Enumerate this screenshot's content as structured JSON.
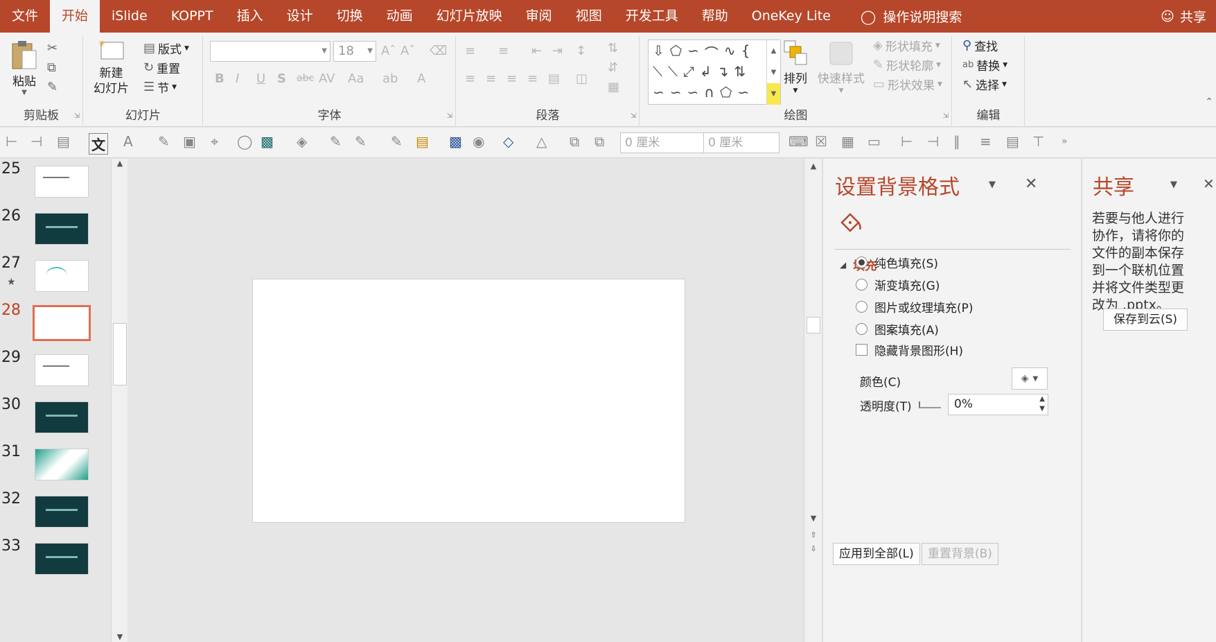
{
  "menubar": {
    "tabs": [
      "文件",
      "开始",
      "iSlide",
      "KOPPT",
      "插入",
      "设计",
      "切换",
      "动画",
      "幻灯片放映",
      "审阅",
      "视图",
      "开发工具",
      "帮助",
      "OneKey Lite"
    ],
    "active_tab": "开始",
    "search_label": "操作说明搜索",
    "share_label": "共享"
  },
  "ribbon": {
    "clipboard": {
      "paste_label": "粘贴",
      "group_label": "剪贴板"
    },
    "slides": {
      "new_slide_label_1": "新建",
      "new_slide_label_2": "幻灯片",
      "layout_label": "版式",
      "reset_label": "重置",
      "section_label": "节",
      "group_label": "幻灯片"
    },
    "font": {
      "font_size": "18",
      "group_label": "字体"
    },
    "paragraph": {
      "group_label": "段落"
    },
    "drawing": {
      "arrange_label": "排列",
      "quick_styles_label": "快速样式",
      "shape_fill_label": "形状填充",
      "shape_outline_label": "形状轮廓",
      "shape_effects_label": "形状效果",
      "group_label": "绘图"
    },
    "editing": {
      "find_label": "查找",
      "replace_label": "替换",
      "select_label": "选择",
      "group_label": "编辑"
    }
  },
  "toolbar2": {
    "height_value": "0 厘米",
    "width_value": "0 厘米",
    "text_tool_label": "文"
  },
  "thumbnails": {
    "slides": [
      {
        "number": "25",
        "style": "light",
        "active": false
      },
      {
        "number": "26",
        "style": "dark",
        "active": false
      },
      {
        "number": "27",
        "style": "light",
        "active": false,
        "star": "★"
      },
      {
        "number": "28",
        "style": "light",
        "active": true
      },
      {
        "number": "29",
        "style": "light",
        "active": false
      },
      {
        "number": "30",
        "style": "dark",
        "active": false
      },
      {
        "number": "31",
        "style": "green",
        "active": false
      },
      {
        "number": "32",
        "style": "dark",
        "active": false
      },
      {
        "number": "33",
        "style": "dark",
        "active": false
      }
    ]
  },
  "format_pane": {
    "title": "设置背景格式",
    "section_label": "填充",
    "options": {
      "solid": "纯色填充(S)",
      "gradient": "渐变填充(G)",
      "picture": "图片或纹理填充(P)",
      "pattern": "图案填充(A)",
      "hide_graphics": "隐藏背景图形(H)"
    },
    "selected_option": "solid",
    "color_label": "颜色(C)",
    "transparency_label": "透明度(T)",
    "transparency_value": "0%",
    "apply_all_label": "应用到全部(L)",
    "reset_label": "重置背景(B)"
  },
  "share_pane": {
    "title": "共享",
    "message": "若要与他人进行协作，请将你的文件的副本保存到一个联机位置并将文件类型更改为 .pptx。",
    "save_button_label": "保存到云(S)"
  },
  "colors": {
    "accent": "#b7472a",
    "ribbon_bg": "#f3f3f3",
    "workspace_bg": "#e6e6e6"
  }
}
